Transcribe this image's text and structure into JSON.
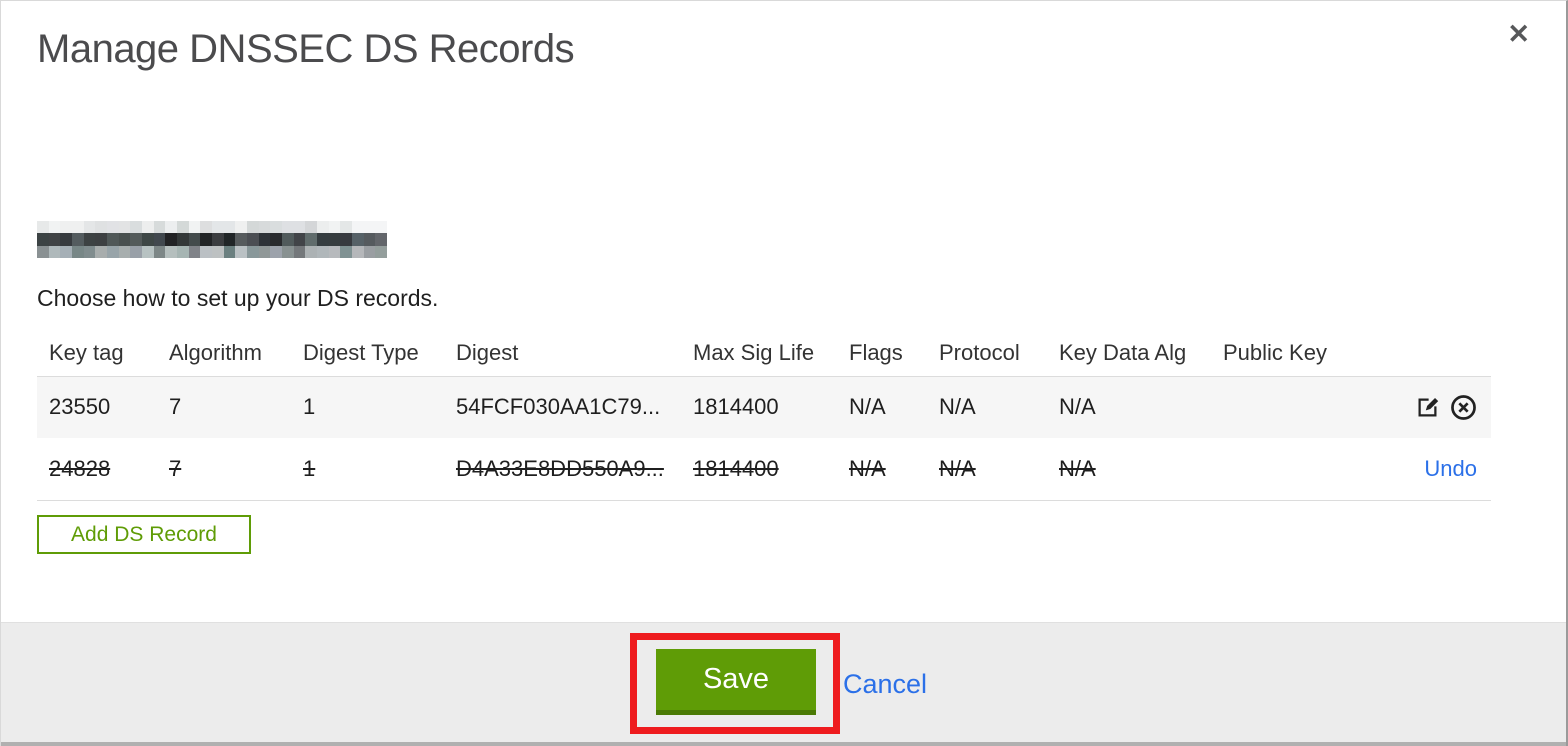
{
  "modal": {
    "title": "Manage DNSSEC DS Records",
    "close_icon": "✕",
    "instruction": "Choose how to set up your DS records."
  },
  "table": {
    "columns": [
      "Key tag",
      "Algorithm",
      "Digest Type",
      "Digest",
      "Max Sig Life",
      "Flags",
      "Protocol",
      "Key Data Alg",
      "Public Key"
    ],
    "rows": [
      {
        "key_tag": "23550",
        "algorithm": "7",
        "digest_type": "1",
        "digest": "54FCF030AA1C79...",
        "max_sig_life": "1814400",
        "flags": "N/A",
        "protocol": "N/A",
        "key_data_alg": "N/A",
        "public_key": "",
        "state": "active"
      },
      {
        "key_tag": "24828",
        "algorithm": "7",
        "digest_type": "1",
        "digest": "D4A33E8DD550A9...",
        "max_sig_life": "1814400",
        "flags": "N/A",
        "protocol": "N/A",
        "key_data_alg": "N/A",
        "public_key": "",
        "state": "deleted",
        "undo_label": "Undo"
      }
    ]
  },
  "buttons": {
    "add_ds_record": "Add DS Record",
    "save": "Save",
    "cancel": "Cancel"
  },
  "colors": {
    "accent_green": "#5f9c06",
    "accent_green_dark": "#4a7a04",
    "link_blue": "#2b70e8",
    "annotation_red": "#ee1b1e",
    "footer_bg": "#ececec",
    "row_highlight": "#f6f6f6"
  }
}
